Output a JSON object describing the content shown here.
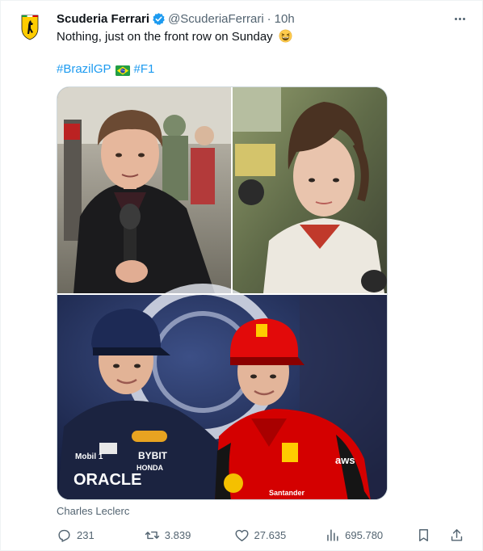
{
  "tweet": {
    "display_name": "Scuderia Ferrari",
    "handle": "@ScuderiaFerrari",
    "separator": "·",
    "time": "10h",
    "text": "Nothing, just on the front row on Sunday",
    "emoji": "grinning-squinting-face",
    "hashtags": [
      "#BrazilGP",
      "#F1"
    ],
    "flag": "brazil-flag",
    "media_alt": "Four photos: two childhood interview shots and a present-day photo of two drivers",
    "media_sponsor_text": [
      "ORACLE",
      "BYBIT",
      "HONDA",
      "Mobil 1",
      "aws",
      "Santander"
    ],
    "caption": "Charles Leclerc"
  },
  "stats": {
    "replies": "231",
    "reposts": "3.839",
    "likes": "27.635",
    "views": "695.780"
  },
  "colors": {
    "accent": "#1d9bf0",
    "muted": "#536471",
    "text": "#0f1419",
    "ferrari_yellow": "#ffcc00",
    "ferrari_red": "#d40000",
    "redbull_navy": "#1b2340"
  }
}
